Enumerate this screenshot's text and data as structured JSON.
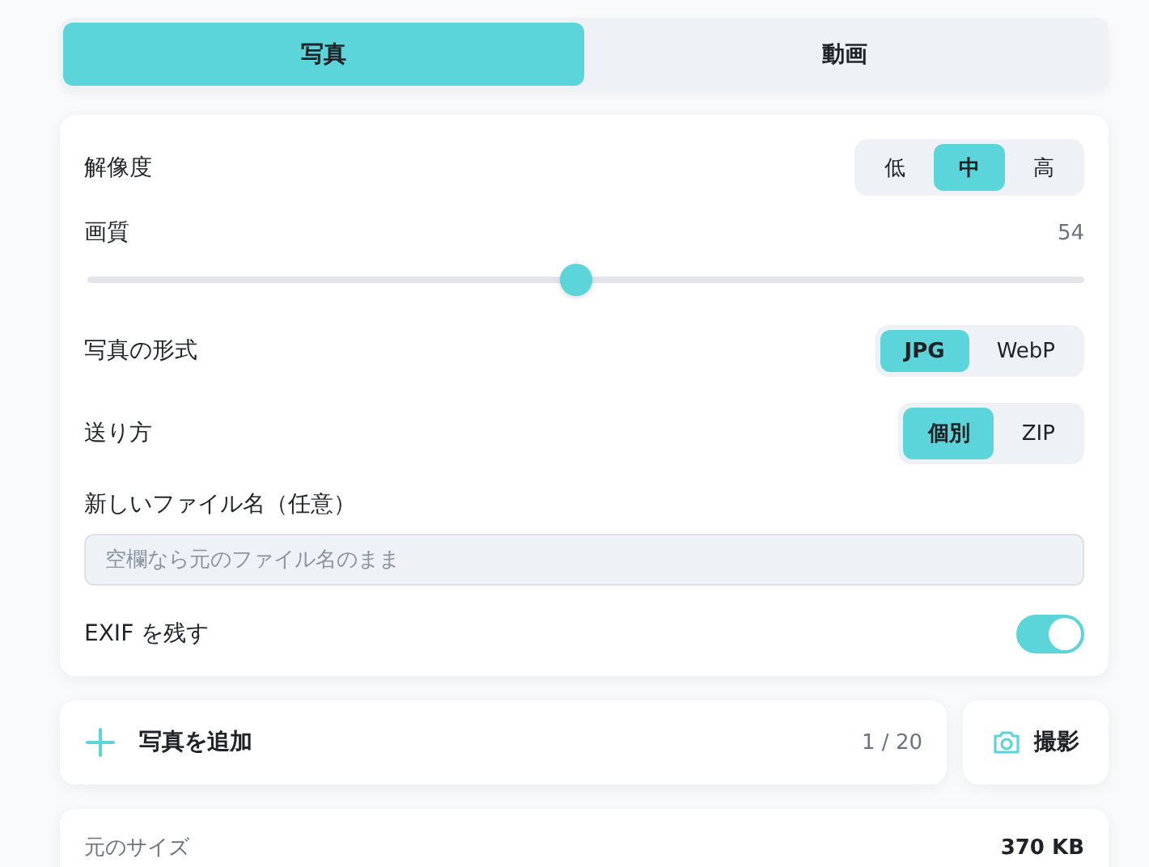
{
  "mode_tabs": [
    {
      "label": "写真",
      "selected": true
    },
    {
      "label": "動画",
      "selected": false
    }
  ],
  "settings": [
    {
      "kind": "segmented",
      "label": "解像度",
      "options": [
        {
          "label": "低",
          "selected": false
        },
        {
          "label": "中",
          "selected": true
        },
        {
          "label": "高",
          "selected": false
        }
      ]
    },
    {
      "kind": "slider",
      "label": "画質",
      "reading": "54",
      "level": 0.49
    },
    {
      "kind": "segmented",
      "label": "写真の形式",
      "options": [
        {
          "label": "JPG",
          "selected": true
        },
        {
          "label": "WebP",
          "selected": false
        }
      ]
    },
    {
      "kind": "segmented",
      "label": "送り方",
      "options": [
        {
          "label": "個別",
          "selected": true
        },
        {
          "label": "ZIP",
          "selected": false
        }
      ]
    },
    {
      "kind": "text_field",
      "label": "新しいファイル名（任意）",
      "placeholder": "空欄なら元のファイル名のまま"
    },
    {
      "kind": "toggle",
      "label": "EXIF を残す",
      "on": true
    }
  ],
  "actions": {
    "add_photo": {
      "label": "写真を追加",
      "count": "1 / 20"
    },
    "camera": {
      "label": "撮影"
    }
  },
  "info": [
    {
      "label": "元のサイズ",
      "value": "370 KB"
    }
  ]
}
